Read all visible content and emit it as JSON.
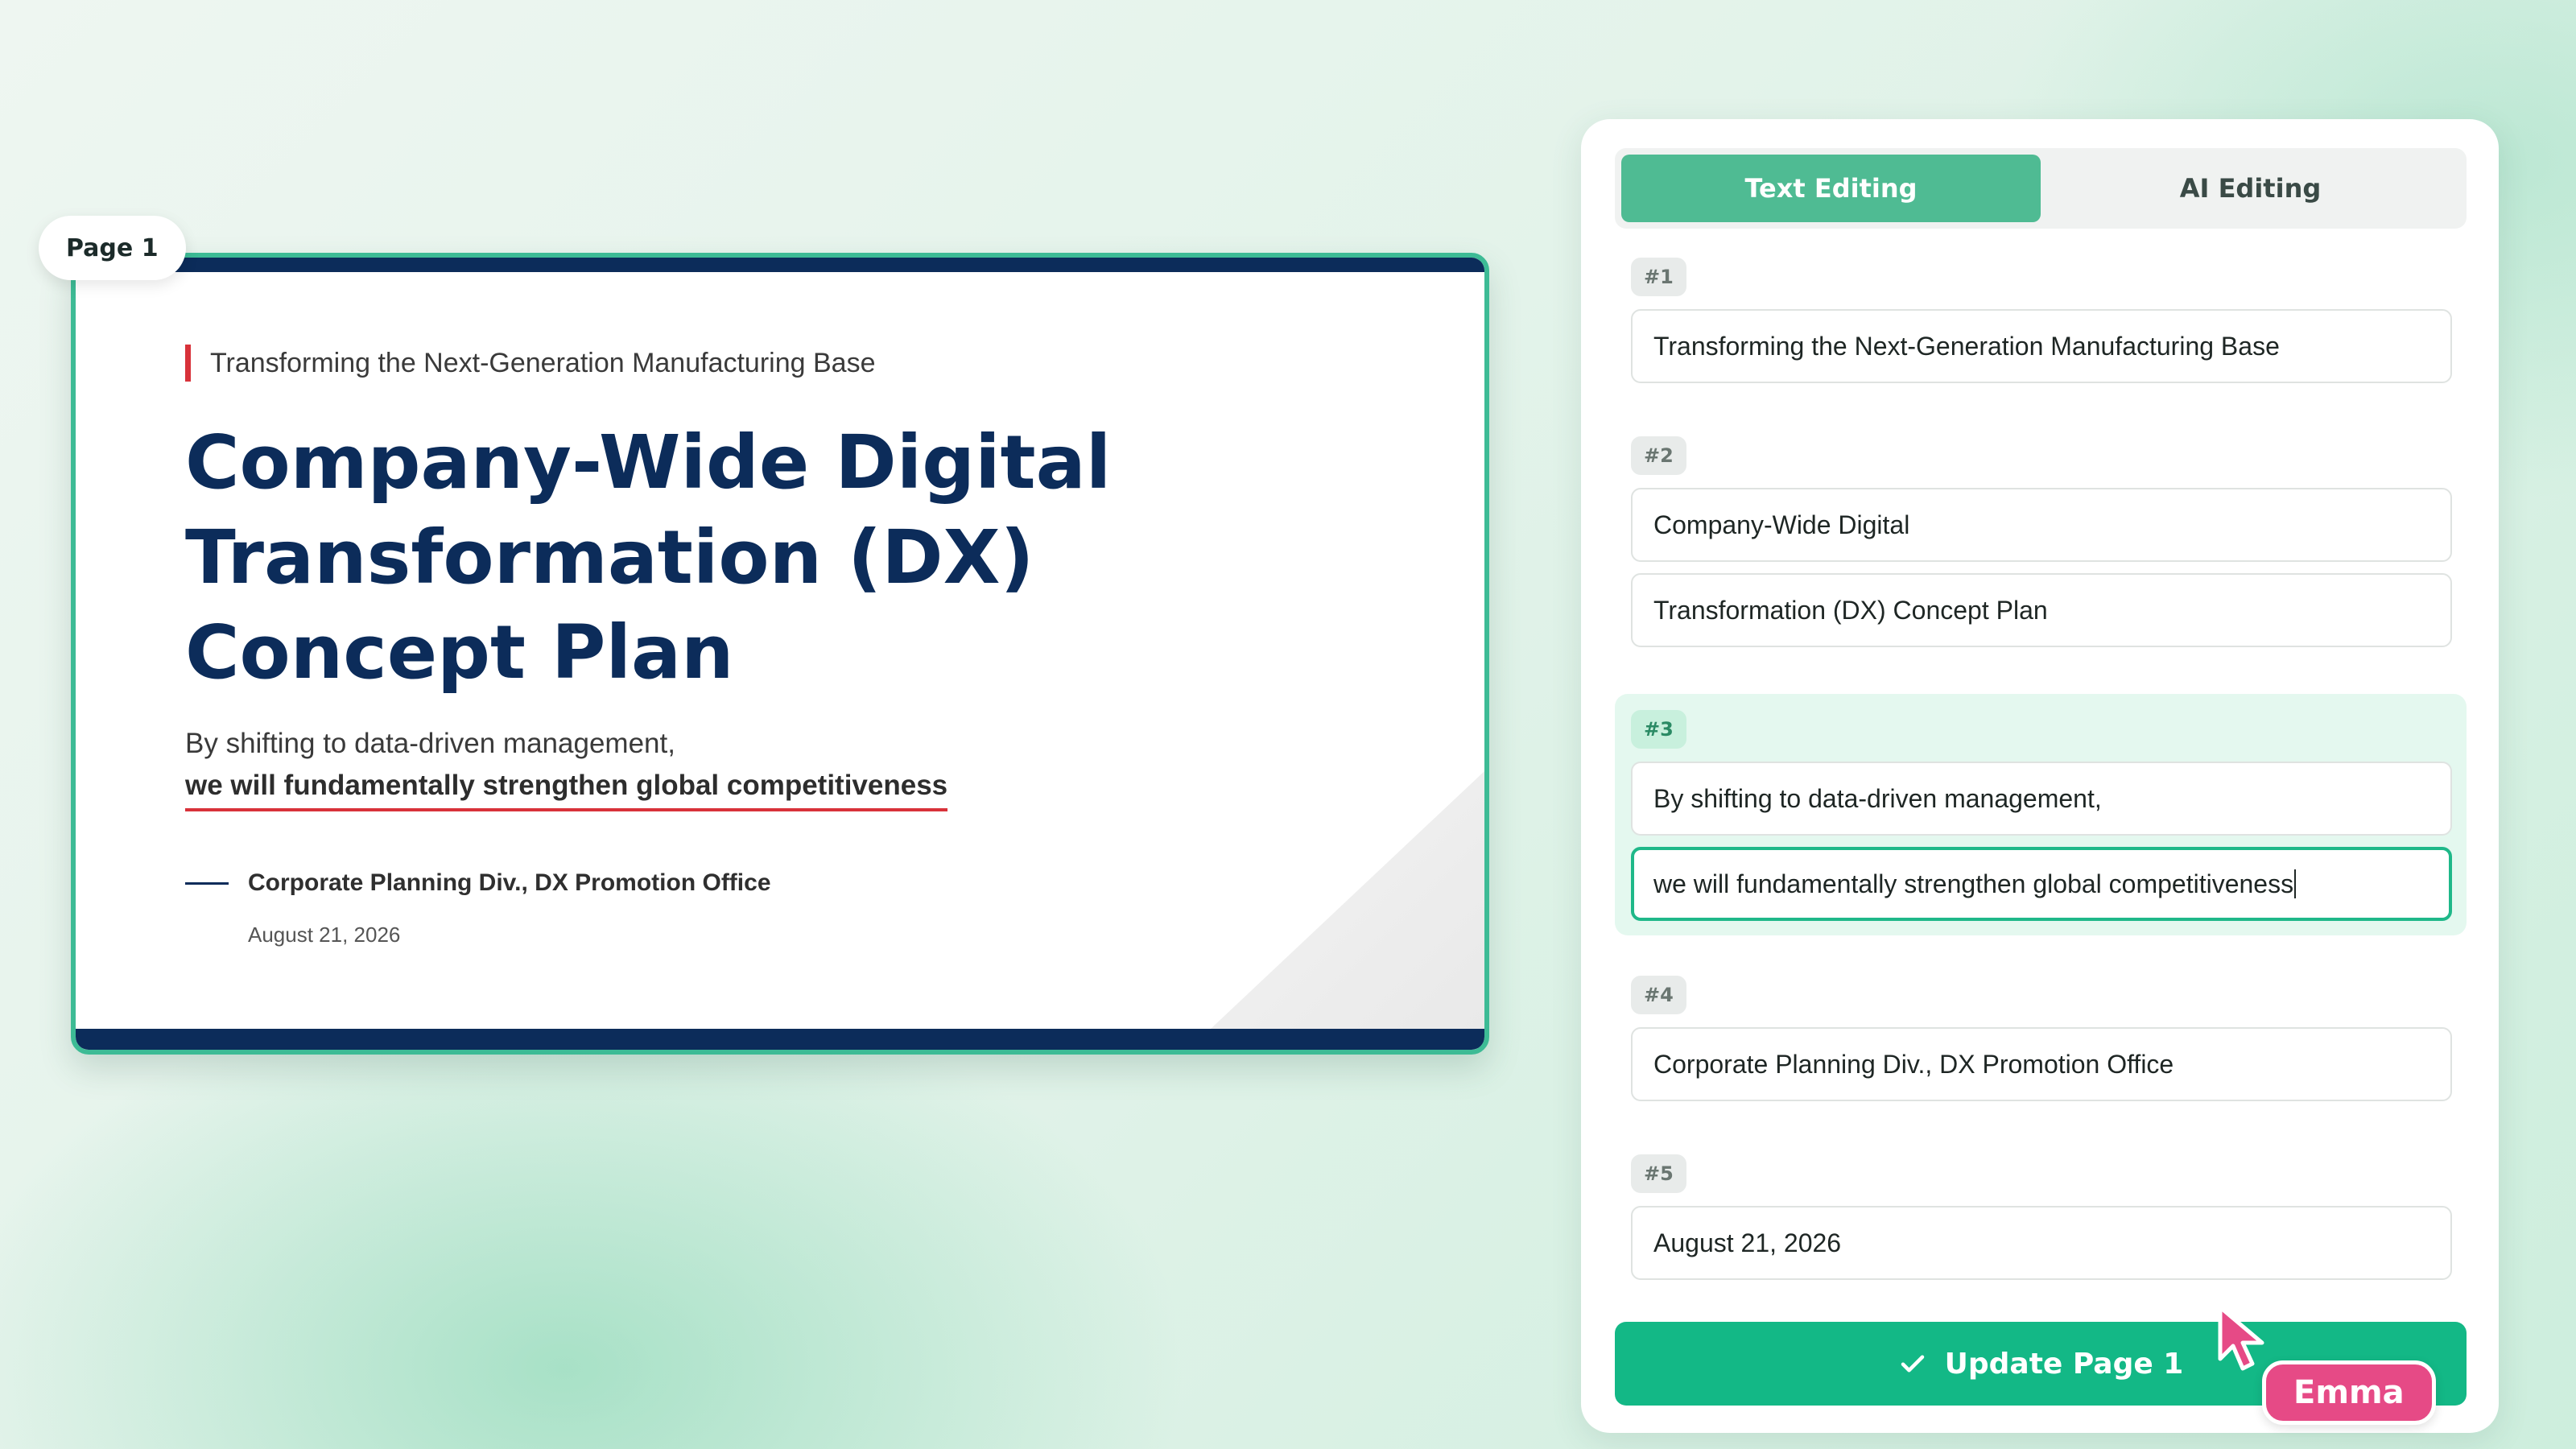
{
  "page_badge": "Page 1",
  "slide": {
    "kicker": "Transforming the Next-Generation Manufacturing Base",
    "title_lines": [
      "Company-Wide Digital",
      "Transformation (DX)",
      "Concept Plan"
    ],
    "subtitle_line1": "By shifting to data-driven management,",
    "subtitle_line2": "we will fundamentally strengthen global competitiveness",
    "organization": "Corporate Planning Div., DX Promotion Office",
    "date": "August 21, 2026"
  },
  "editor": {
    "tabs": [
      {
        "label": "Text Editing",
        "active": true
      },
      {
        "label": "AI Editing",
        "active": false
      }
    ],
    "groups": [
      {
        "chip": "#1",
        "fields": [
          "Transforming the Next-Generation Manufacturing Base"
        ]
      },
      {
        "chip": "#2",
        "fields": [
          "Company-Wide Digital",
          "Transformation (DX) Concept Plan"
        ]
      },
      {
        "chip": "#3",
        "fields": [
          "By shifting to data-driven management,",
          "we will fundamentally strengthen global competitiveness"
        ]
      },
      {
        "chip": "#4",
        "fields": [
          "Corporate Planning Div., DX Promotion Office"
        ]
      },
      {
        "chip": "#5",
        "fields": [
          "August 21, 2026"
        ]
      }
    ],
    "update_button": "Update Page 1",
    "icons": {
      "update": "check-icon"
    }
  },
  "collaborator": {
    "name": "Emma",
    "color": "#e64a86",
    "icon": "cursor-icon"
  },
  "colors": {
    "accent": "#13b886",
    "slide_navy": "#0c2c5a",
    "slide_red": "#d8323a"
  }
}
